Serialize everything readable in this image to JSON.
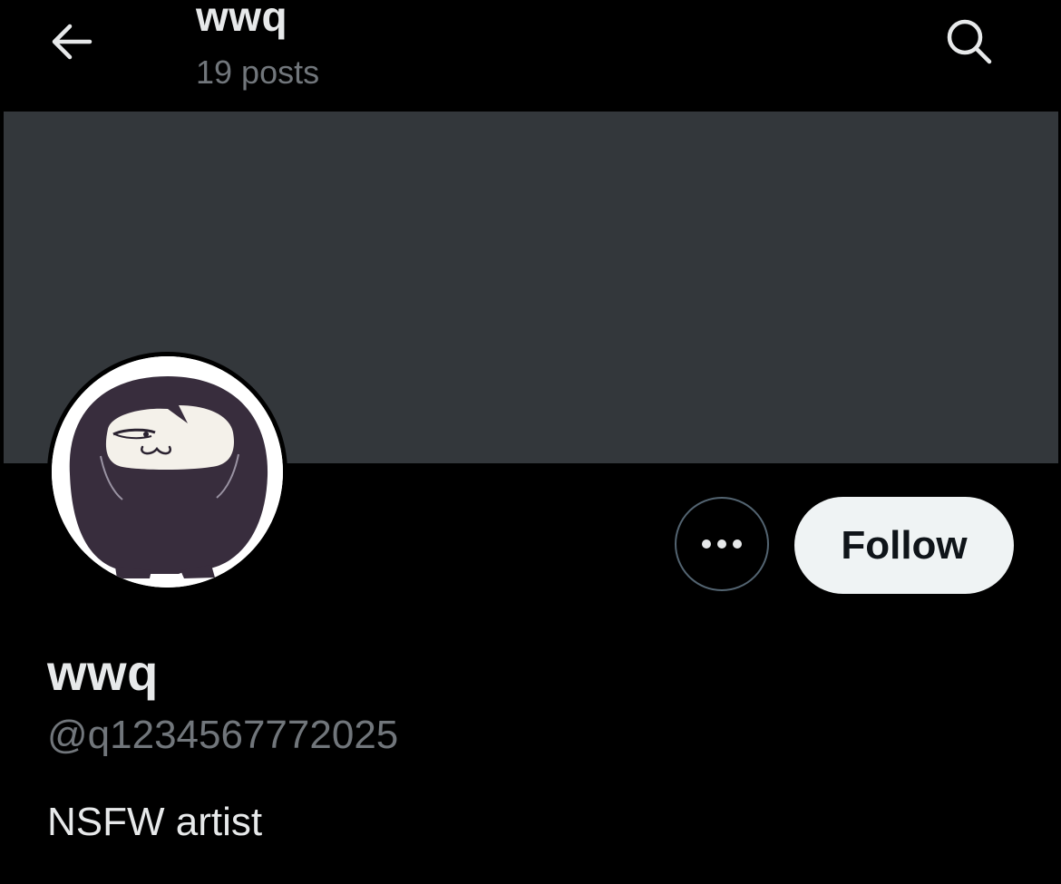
{
  "header": {
    "title": "wwq",
    "post_count": "19 posts",
    "back_icon": "arrow-left-icon",
    "search_icon": "search-icon"
  },
  "profile": {
    "display_name": "wwq",
    "handle": "@q1234567772025",
    "bio": "NSFW artist",
    "follow_label": "Follow",
    "more_icon": "more-horizontal-icon"
  },
  "colors": {
    "background": "#000000",
    "banner": "#33373b",
    "primary_text": "#e7e9ea",
    "secondary_text": "#71767b",
    "follow_bg": "#eff3f4",
    "follow_text": "#0f1419",
    "outline": "#536471"
  }
}
